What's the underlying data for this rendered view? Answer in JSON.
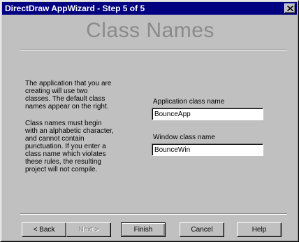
{
  "window": {
    "title": "DirectDraw AppWizard - Step 5 of 5"
  },
  "heading": "Class Names",
  "description": {
    "para1": "The application that you are creating will use two classes. The default class names appear on the right.",
    "para2": "Class names must begin with an alphabetic character, and cannot contain punctuation. If you enter a class name which violates these rules, the resulting project will not compile."
  },
  "fields": {
    "app_class": {
      "label": "Application class name",
      "value": "BounceApp"
    },
    "window_class": {
      "label": "Window class name",
      "value": "BounceWin"
    }
  },
  "buttons": {
    "back": "< Back",
    "next": "Next >",
    "finish": "Finish",
    "cancel": "Cancel",
    "help": "Help"
  },
  "states": {
    "next_disabled": true,
    "default_button": "finish"
  },
  "colors": {
    "titlebar": "#000080",
    "face": "#c0c0c0",
    "heading": "#8a8a8a"
  }
}
